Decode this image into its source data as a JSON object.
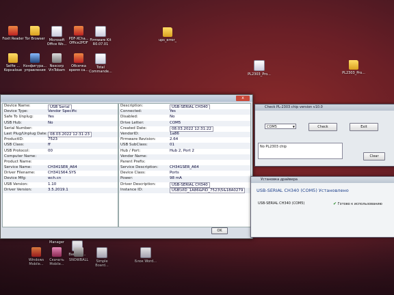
{
  "desktop": {
    "icons": [
      {
        "label": "Foxit Reader",
        "kind": "red"
      },
      {
        "label": "Tor Browser",
        "kind": "folder"
      },
      {
        "label": "Microsoft Office Wo...",
        "kind": "doc"
      },
      {
        "label": "PDF-XCha... Office2PDF",
        "kind": "red"
      },
      {
        "label": "Firmware Kit R0.07.01",
        "kind": "doc"
      },
      {
        "label": "ups_error_",
        "kind": "folder"
      },
      {
        "label": "Selfie ... Kopнaloue",
        "kind": "folder"
      },
      {
        "label": "Конфигура... управления",
        "kind": "blue"
      },
      {
        "label": "Nexcorp VinTobam",
        "kind": "gray"
      },
      {
        "label": "Обсечка время ca...",
        "kind": "red"
      },
      {
        "label": "Total Commande...",
        "kind": "doc"
      },
      {
        "label": "PL2303_Pro...",
        "kind": "doc"
      },
      {
        "label": "PL2303_Pro...",
        "kind": "folder"
      }
    ],
    "bottom_icons": [
      {
        "label": "Star file Manager",
        "kind": "gray"
      },
      {
        "label": "Barcode...",
        "kind": "doc"
      },
      {
        "label": "Скачать Mobile...",
        "kind": "music"
      },
      {
        "label": "Windows Mobile...",
        "kind": "red"
      },
      {
        "label": "SNOWBALL",
        "kind": "gray"
      },
      {
        "label": "Simple Board...",
        "kind": "doc"
      },
      {
        "label": "Блок Word...",
        "kind": "doc"
      }
    ]
  },
  "device_window": {
    "close_label": "x",
    "left_rows": [
      {
        "key": "Device Name:",
        "value": "USB Serial",
        "style": "box"
      },
      {
        "key": "Device Type:",
        "value": "Vendor Specific",
        "style": "plain"
      },
      {
        "key": "Safe To Unplug:",
        "value": "Yes",
        "style": "plain"
      },
      {
        "key": "USB Hub:",
        "value": "No",
        "style": "plain"
      },
      {
        "key": "Serial Number:",
        "value": "",
        "style": "plain"
      },
      {
        "key": "Last Plug/Unplug Date:",
        "value": "08.03.2022 12:31:23",
        "style": "box"
      },
      {
        "key": "ProductID:",
        "value": "7523",
        "style": "plain"
      },
      {
        "key": "USB Class:",
        "value": "ff",
        "style": "plain"
      },
      {
        "key": "USB Protocol:",
        "value": "00",
        "style": "plain"
      },
      {
        "key": "Computer Name:",
        "value": "",
        "style": "plain"
      },
      {
        "key": "Product Name:",
        "value": "",
        "style": "plain"
      },
      {
        "key": "Service Name:",
        "value": "CH341SER_A64",
        "style": "plain"
      },
      {
        "key": "Driver Filename:",
        "value": "CH341S64.SYS",
        "style": "plain"
      },
      {
        "key": "Device Mfg:",
        "value": "wch.cn",
        "style": "plain"
      },
      {
        "key": "USB Version:",
        "value": "1.10",
        "style": "plain"
      },
      {
        "key": "Driver Version:",
        "value": "3.5.2019.1",
        "style": "plain"
      }
    ],
    "right_rows": [
      {
        "key": "Description:",
        "value": "USB-SERIAL CH340",
        "style": "box"
      },
      {
        "key": "Connected:",
        "value": "Yes",
        "style": "plain"
      },
      {
        "key": "Disabled:",
        "value": "No",
        "style": "plain"
      },
      {
        "key": "Drive Letter:",
        "value": "COM5",
        "style": "plain"
      },
      {
        "key": "Created Date:",
        "value": "08.03.2022 12:31:22",
        "style": "box"
      },
      {
        "key": "VendorID:",
        "value": "1a86",
        "style": "plain"
      },
      {
        "key": "Firmware Revision:",
        "value": "2.64",
        "style": "plain"
      },
      {
        "key": "USB SubClass:",
        "value": "01",
        "style": "plain"
      },
      {
        "key": "Hub / Port:",
        "value": "Hub 2, Port 2",
        "style": "plain"
      },
      {
        "key": "Vendor Name:",
        "value": "",
        "style": "plain"
      },
      {
        "key": "Parent Prefix:",
        "value": "",
        "style": "plain"
      },
      {
        "key": "Service Description:",
        "value": "CH341SER_A64",
        "style": "plain"
      },
      {
        "key": "Device Class:",
        "value": "Ports",
        "style": "plain"
      },
      {
        "key": "Power:",
        "value": "98 mA",
        "style": "plain"
      },
      {
        "key": "Driver Description:",
        "value": "USB-SERIAL CH340",
        "style": "box"
      },
      {
        "key": "Instance ID:",
        "value": "USB\\VID_1A86&PID_7523\\5&18A0279",
        "style": "box"
      }
    ],
    "ok_label": "OK"
  },
  "check_window": {
    "title": "Check PL-2303 chip version v10.0",
    "port_value": "COM5",
    "check_label": "Check",
    "exit_label": "Exit",
    "result_text": "No PL2303 chip",
    "clear_label": "Clear"
  },
  "driver_window": {
    "title": "Установка драйвера",
    "heading": "USB-SERIAL CH340 (COM5) Установлено",
    "device": "USB-SERIAL CH340 (COM5)",
    "status": "Готово к использованию"
  }
}
